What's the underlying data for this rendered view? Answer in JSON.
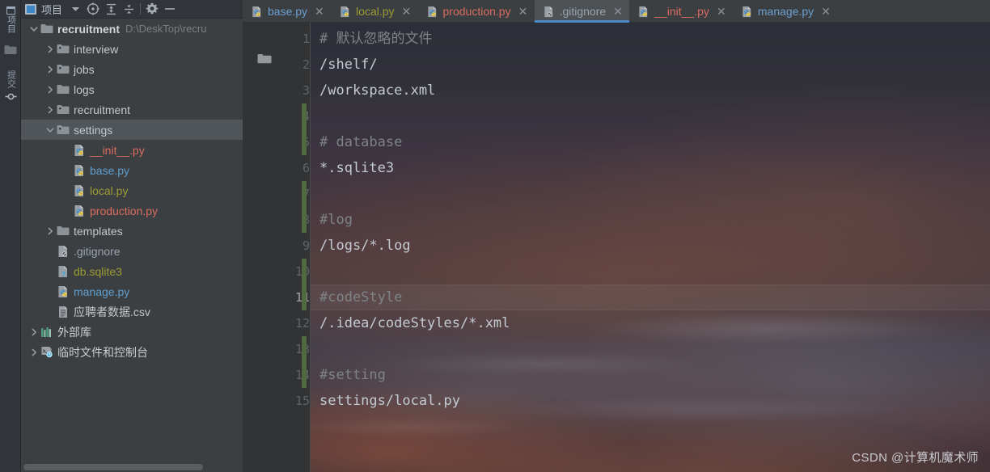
{
  "toolstrip": {
    "project_label": "项目",
    "commit_label": "提交",
    "folder_icon": "folder-icon",
    "structure_icon": "structure-icon"
  },
  "project_toolbar": {
    "title": "项目",
    "dropdown_icon": "chevron-down-icon",
    "locate_icon": "locate-target-icon",
    "expand_icon": "expand-all-icon",
    "collapse_icon": "collapse-all-icon",
    "settings_icon": "gear-icon",
    "hide_icon": "minimize-icon"
  },
  "tree": [
    {
      "label": "recruitment",
      "path": "D:\\DeskTop\\recru",
      "depth": 0,
      "arrow": "down",
      "icon": "folder-icon",
      "style": "c-root",
      "selected": false
    },
    {
      "label": "interview",
      "path": "",
      "depth": 1,
      "arrow": "right",
      "icon": "module-folder-icon",
      "style": "c-dir",
      "selected": false
    },
    {
      "label": "jobs",
      "path": "",
      "depth": 1,
      "arrow": "right",
      "icon": "module-folder-icon",
      "style": "c-dir",
      "selected": false
    },
    {
      "label": "logs",
      "path": "",
      "depth": 1,
      "arrow": "right",
      "icon": "folder-icon",
      "style": "c-dir",
      "selected": false
    },
    {
      "label": "recruitment",
      "path": "",
      "depth": 1,
      "arrow": "right",
      "icon": "module-folder-icon",
      "style": "c-dir",
      "selected": false
    },
    {
      "label": "settings",
      "path": "",
      "depth": 1,
      "arrow": "down",
      "icon": "module-folder-icon",
      "style": "c-dir",
      "selected": true
    },
    {
      "label": "__init__.py",
      "path": "",
      "depth": 2,
      "arrow": "none",
      "icon": "python-file-icon",
      "style": "c-py-red",
      "selected": false
    },
    {
      "label": "base.py",
      "path": "",
      "depth": 2,
      "arrow": "none",
      "icon": "python-file-icon",
      "style": "c-py-blue",
      "selected": false
    },
    {
      "label": "local.py",
      "path": "",
      "depth": 2,
      "arrow": "none",
      "icon": "python-file-icon",
      "style": "c-py-olive",
      "selected": false
    },
    {
      "label": "production.py",
      "path": "",
      "depth": 2,
      "arrow": "none",
      "icon": "python-file-icon",
      "style": "c-py-red",
      "selected": false
    },
    {
      "label": "templates",
      "path": "",
      "depth": 1,
      "arrow": "right",
      "icon": "folder-icon",
      "style": "c-dir",
      "selected": false
    },
    {
      "label": ".gitignore",
      "path": "",
      "depth": 1,
      "arrow": "none",
      "icon": "gitignore-file-icon",
      "style": "c-gitignore",
      "selected": false
    },
    {
      "label": "db.sqlite3",
      "path": "",
      "depth": 1,
      "arrow": "none",
      "icon": "unknown-file-icon",
      "style": "c-sqlite",
      "selected": false
    },
    {
      "label": "manage.py",
      "path": "",
      "depth": 1,
      "arrow": "none",
      "icon": "python-file-icon",
      "style": "c-py-blue",
      "selected": false
    },
    {
      "label": "应聘者数据.csv",
      "path": "",
      "depth": 1,
      "arrow": "none",
      "icon": "csv-file-icon",
      "style": "c-csv",
      "selected": false
    },
    {
      "label": "外部库",
      "path": "",
      "depth": 0,
      "arrow": "right",
      "icon": "external-libraries-icon",
      "style": "c-plain",
      "selected": false
    },
    {
      "label": "临时文件和控制台",
      "path": "",
      "depth": 0,
      "arrow": "right",
      "icon": "scratches-consoles-icon",
      "style": "c-plain",
      "selected": false
    }
  ],
  "tabs": [
    {
      "label": "base.py",
      "icon": "python-file-icon",
      "color": "#6a9fd0",
      "active": false,
      "close": "✕"
    },
    {
      "label": "local.py",
      "icon": "python-file-icon",
      "color": "#9c9b33",
      "active": false,
      "close": "✕"
    },
    {
      "label": "production.py",
      "icon": "python-file-icon",
      "color": "#d96c5f",
      "active": false,
      "close": "✕"
    },
    {
      "label": ".gitignore",
      "icon": "gitignore-file-icon",
      "color": "#9aa5b0",
      "active": true,
      "close": "✕"
    },
    {
      "label": "__init__.py",
      "icon": "python-file-icon",
      "color": "#d96c5f",
      "active": false,
      "close": "✕"
    },
    {
      "label": "manage.py",
      "icon": "python-file-icon",
      "color": "#6a9fd0",
      "active": false,
      "close": "✕"
    }
  ],
  "editor": {
    "current_line": 11,
    "lines": [
      {
        "n": 1,
        "text": "# 默认忽略的文件",
        "kind": "comment",
        "changed": false
      },
      {
        "n": 2,
        "text": "/shelf/",
        "kind": "text",
        "changed": false
      },
      {
        "n": 3,
        "text": "/workspace.xml",
        "kind": "text",
        "changed": false
      },
      {
        "n": 4,
        "text": "",
        "kind": "text",
        "changed": true
      },
      {
        "n": 5,
        "text": "# database",
        "kind": "comment",
        "changed": true
      },
      {
        "n": 6,
        "text": "*.sqlite3",
        "kind": "text",
        "changed": false
      },
      {
        "n": 7,
        "text": "",
        "kind": "text",
        "changed": true
      },
      {
        "n": 8,
        "text": "#log",
        "kind": "comment",
        "changed": true
      },
      {
        "n": 9,
        "text": "/logs/*.log",
        "kind": "text",
        "changed": false
      },
      {
        "n": 10,
        "text": "",
        "kind": "text",
        "changed": true
      },
      {
        "n": 11,
        "text": "#codeStyle",
        "kind": "comment",
        "changed": true
      },
      {
        "n": 12,
        "text": "/.idea/codeStyles/*.xml",
        "kind": "text",
        "changed": false
      },
      {
        "n": 13,
        "text": "",
        "kind": "text",
        "changed": true
      },
      {
        "n": 14,
        "text": "#setting",
        "kind": "comment",
        "changed": true
      },
      {
        "n": 15,
        "text": "settings/local.py",
        "kind": "text",
        "changed": false
      }
    ]
  },
  "watermark": "CSDN @计算机魔术师",
  "colors": {
    "panel_bg": "#3c3f41",
    "toolbar_bg": "#313438",
    "editor_gutter": "#313335",
    "accent_blue": "#4a88c7",
    "selection": "#4f5559",
    "change_green": "#4f6a3f"
  }
}
